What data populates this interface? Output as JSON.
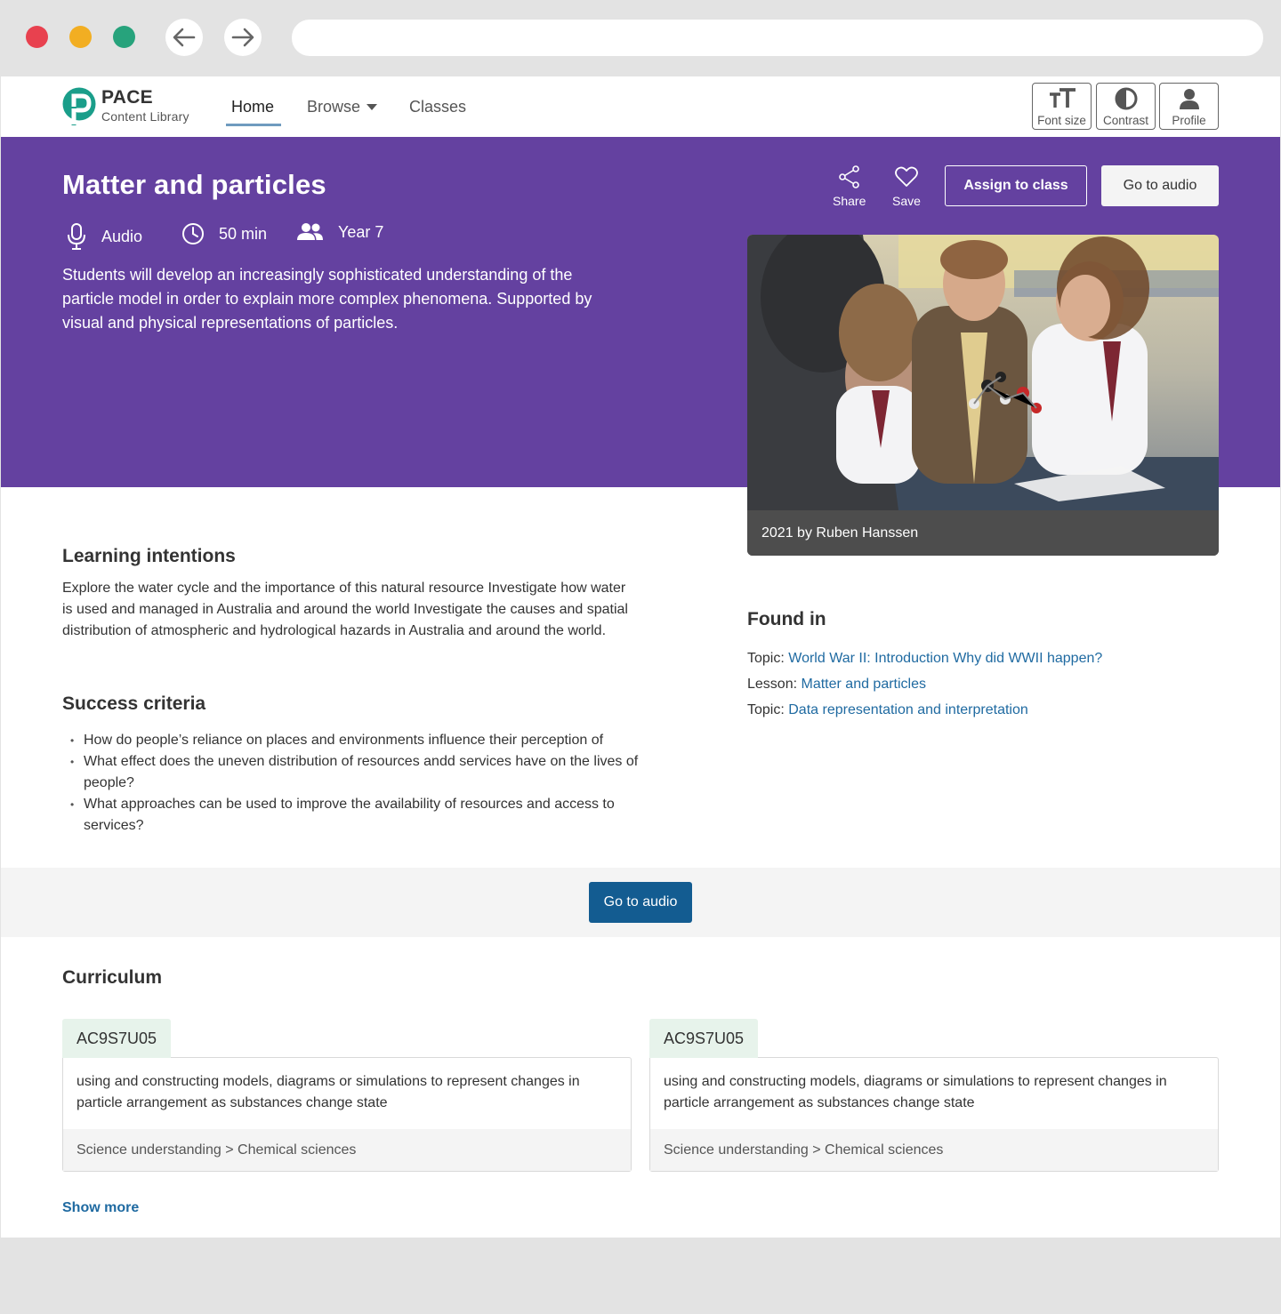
{
  "header": {
    "brand_title": "PACE",
    "brand_subtitle": "Content Library",
    "nav": {
      "home": "Home",
      "browse": "Browse",
      "classes": "Classes"
    },
    "tools": {
      "font_size": "Font size",
      "contrast": "Contrast",
      "profile": "Profile"
    }
  },
  "hero": {
    "title": "Matter and particles",
    "meta": {
      "type": "Audio",
      "duration": "50 min",
      "year": "Year 7"
    },
    "description": "Students will develop an increasingly sophisticated understanding of the particle model in order to explain more complex phenomena. Supported by visual and physical representations of particles.",
    "actions": {
      "share": "Share",
      "save": "Save",
      "assign": "Assign to class",
      "go_to_audio": "Go to audio"
    },
    "image_caption": "2021 by Ruben Hanssen"
  },
  "learning": {
    "heading": "Learning intentions",
    "text": "Explore the water cycle and the importance of this natural resource Investigate how water is used and managed in Australia and around the world Investigate the causes and spatial distribution of atmospheric and hydrological hazards in Australia and around the world."
  },
  "success": {
    "heading": "Success criteria",
    "items": [
      "How do people’s reliance on places and environments influence their perception of",
      "What effect does the uneven distribution of resources andd services have on the lives of people?",
      "What approaches can be used to improve the availability of resources and access to services?"
    ]
  },
  "found_in": {
    "heading": "Found in",
    "items": [
      {
        "label": "Topic:",
        "link": "World War II: Introduction Why did WWII happen?"
      },
      {
        "label": "Lesson:",
        "link": "Matter and particles"
      },
      {
        "label": "Topic:",
        "link": "Data representation and interpretation"
      }
    ]
  },
  "band": {
    "go_to_audio": "Go to audio"
  },
  "curriculum": {
    "heading": "Curriculum",
    "cards": [
      {
        "code": "AC9S7U05",
        "text": "using and constructing models, diagrams or simulations to represent changes in particle arrangement as substances change state",
        "path": "Science understanding > Chemical sciences"
      },
      {
        "code": "AC9S7U05",
        "text": "using and constructing models, diagrams or simulations to represent changes in particle arrangement as substances change state",
        "path": "Science understanding > Chemical sciences"
      }
    ],
    "show_more": "Show more"
  },
  "colors": {
    "hero": "#6441a0",
    "primary_button": "#135c91",
    "link": "#1f6aa1",
    "brand": "#1a9e8a"
  }
}
